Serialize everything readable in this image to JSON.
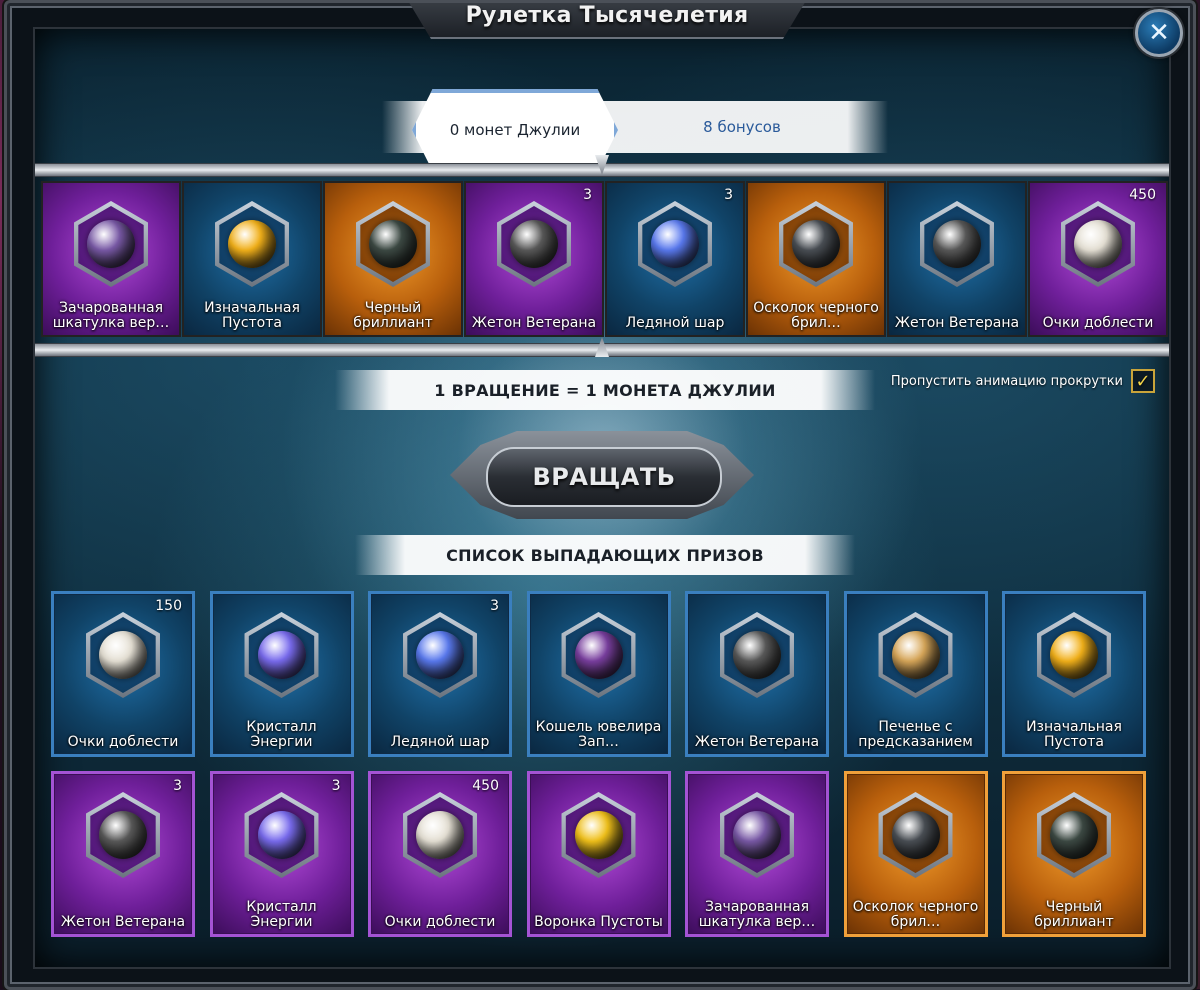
{
  "window": {
    "title": "Рулетка Тысячелетия",
    "close_symbol": "✕"
  },
  "currency": {
    "coins_tab": "0 монет Джулии",
    "bonus_tab": "8 бонусов"
  },
  "reel": [
    {
      "label": "Зачарованная шкатулка вер…",
      "rarity": "purple",
      "qty": "",
      "icon": "enchanted-box-icon",
      "orb": "#7a5aa8"
    },
    {
      "label": "Изначальная Пустота",
      "rarity": "blue",
      "qty": "",
      "icon": "primal-void-icon",
      "orb": "#f4b21a"
    },
    {
      "label": "Черный бриллиант",
      "rarity": "orange",
      "qty": "",
      "icon": "black-diamond-icon",
      "orb": "#3d4a44"
    },
    {
      "label": "Жетон Ветерана",
      "rarity": "purple",
      "qty": "3",
      "icon": "veteran-token-icon",
      "orb": "#5a5a5a"
    },
    {
      "label": "Ледяной шар",
      "rarity": "blue",
      "qty": "3",
      "icon": "ice-orb-icon",
      "orb": "#5a7af0"
    },
    {
      "label": "Осколок черного брил…",
      "rarity": "orange",
      "qty": "",
      "icon": "black-diamond-shard-icon",
      "orb": "#4a4f55"
    },
    {
      "label": "Жетон Ветерана",
      "rarity": "blue",
      "qty": "",
      "icon": "veteran-token-icon",
      "orb": "#5a5a5a"
    },
    {
      "label": "Очки доблести",
      "rarity": "purple",
      "qty": "450",
      "icon": "valor-points-icon",
      "orb": "#e7e2d6"
    }
  ],
  "spin": {
    "cost_text": "1 ВРАЩЕНИЕ = 1 МОНЕТА ДЖУЛИИ",
    "skip_animation_label": "Пропустить анимацию прокрутки",
    "skip_checked_symbol": "✓",
    "button_label": "ВРАЩАТЬ"
  },
  "prizes": {
    "header": "СПИСОК ВЫПАДАЮЩИХ ПРИЗОВ",
    "row1": [
      {
        "label": "Очки доблести",
        "rarity": "blue",
        "qty": "150",
        "icon": "valor-points-icon",
        "orb": "#e7e2d6"
      },
      {
        "label": "Кристалл Энергии",
        "rarity": "blue",
        "qty": "",
        "icon": "energy-crystal-icon",
        "orb": "#7a6cf0"
      },
      {
        "label": "Ледяной шар",
        "rarity": "blue",
        "qty": "3",
        "icon": "ice-orb-icon",
        "orb": "#5a7af0"
      },
      {
        "label": "Кошель ювелира Зап…",
        "rarity": "blue",
        "qty": "",
        "icon": "jeweler-pouch-icon",
        "orb": "#7a3fa0"
      },
      {
        "label": "Жетон Ветерана",
        "rarity": "blue",
        "qty": "",
        "icon": "veteran-token-icon",
        "orb": "#5a5a5a"
      },
      {
        "label": "Печенье с предсказанием",
        "rarity": "blue",
        "qty": "",
        "icon": "fortune-cookie-icon",
        "orb": "#d9a85a"
      },
      {
        "label": "Изначальная Пустота",
        "rarity": "blue",
        "qty": "",
        "icon": "primal-void-icon",
        "orb": "#f4b21a"
      }
    ],
    "row2": [
      {
        "label": "Жетон Ветерана",
        "rarity": "purple",
        "qty": "3",
        "icon": "veteran-token-icon",
        "orb": "#5a5a5a"
      },
      {
        "label": "Кристалл Энергии",
        "rarity": "purple",
        "qty": "3",
        "icon": "energy-crystal-icon",
        "orb": "#7a6cf0"
      },
      {
        "label": "Очки доблести",
        "rarity": "purple",
        "qty": "450",
        "icon": "valor-points-icon",
        "orb": "#e7e2d6"
      },
      {
        "label": "Воронка Пустоты",
        "rarity": "purple",
        "qty": "",
        "icon": "void-funnel-icon",
        "orb": "#f2c21a"
      },
      {
        "label": "Зачарованная шкатулка вер…",
        "rarity": "purple",
        "qty": "",
        "icon": "enchanted-box-icon",
        "orb": "#7a5aa8"
      },
      {
        "label": "Осколок черного брил…",
        "rarity": "orange",
        "qty": "",
        "icon": "black-diamond-shard-icon",
        "orb": "#4a4f55"
      },
      {
        "label": "Черный бриллиант",
        "rarity": "orange",
        "qty": "",
        "icon": "black-diamond-icon",
        "orb": "#3d4a44"
      }
    ]
  }
}
